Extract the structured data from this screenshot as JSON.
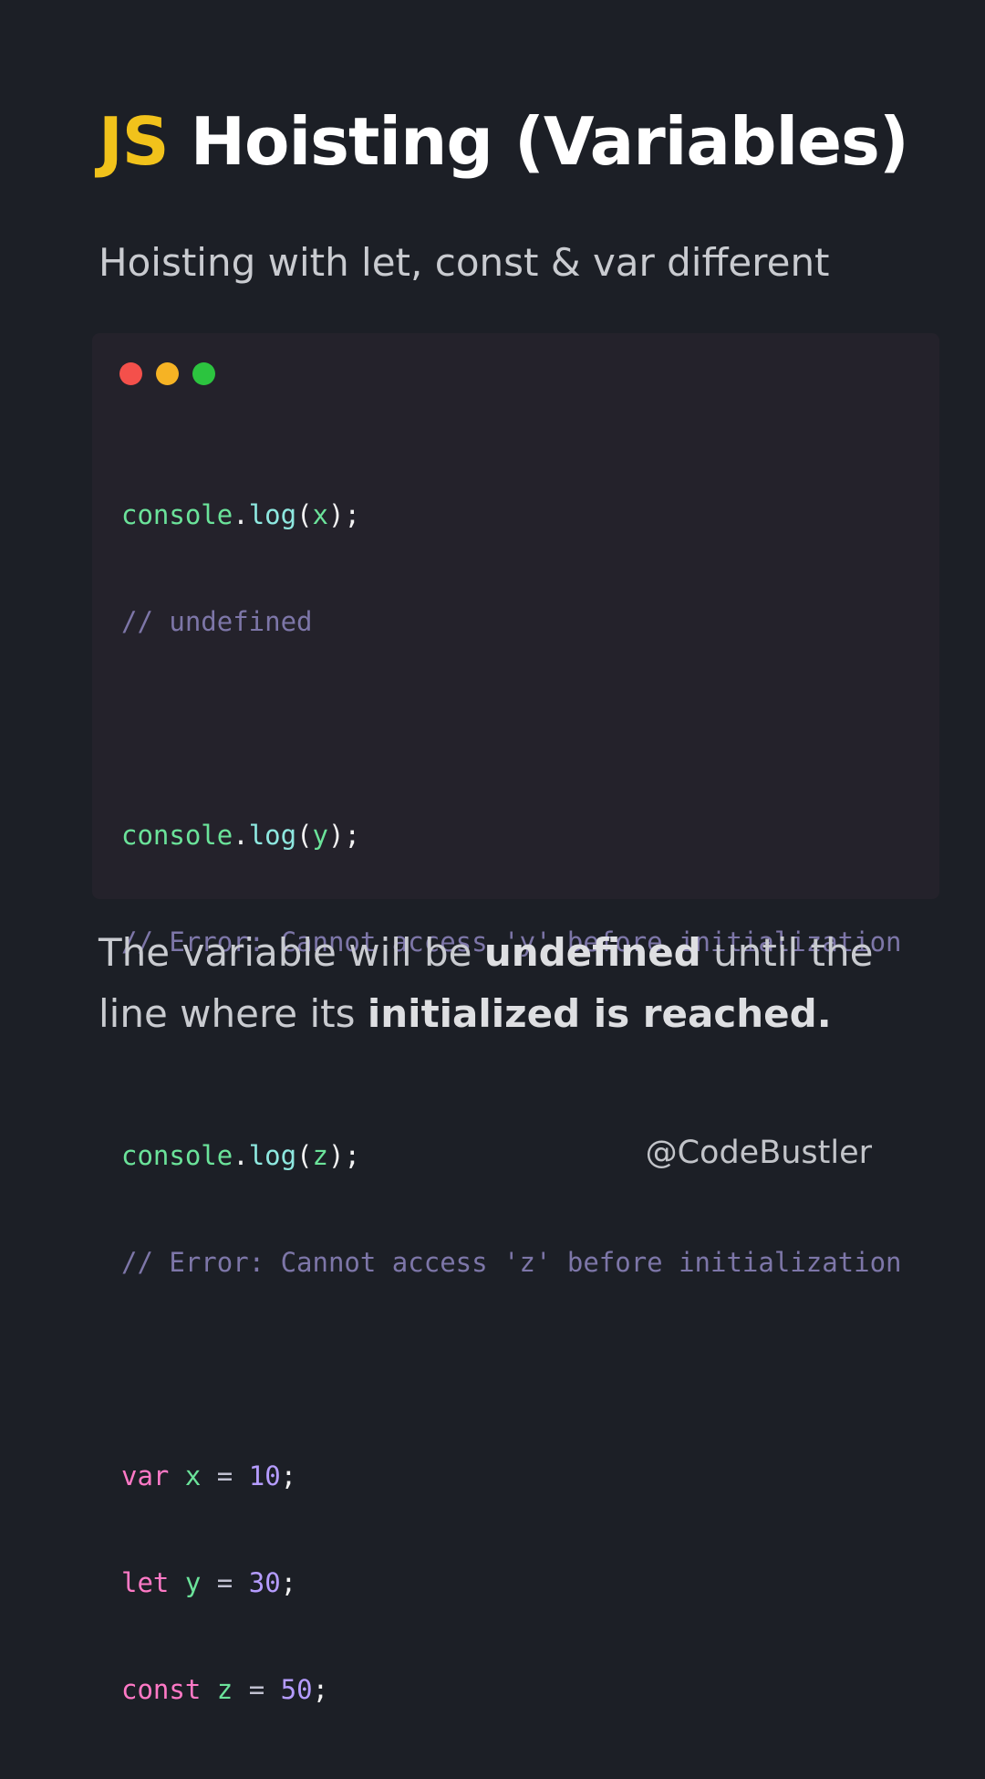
{
  "header": {
    "title_accent": "JS",
    "title_rest": "Hoisting (Variables)",
    "subtitle": "Hoisting with let, const & var different"
  },
  "code_window": {
    "controls": [
      "close",
      "minimize",
      "maximize"
    ],
    "lines": {
      "l1": {
        "obj": "console",
        "dot": ".",
        "method": "log",
        "open": "(",
        "arg": "x",
        "close": ");"
      },
      "l2": {
        "comment": "// undefined"
      },
      "l3": {
        "obj": "console",
        "dot": ".",
        "method": "log",
        "open": "(",
        "arg": "y",
        "close": ");"
      },
      "l4": {
        "comment": "// Error: Cannot access 'y' before initialization"
      },
      "l5": {
        "obj": "console",
        "dot": ".",
        "method": "log",
        "open": "(",
        "arg": "z",
        "close": ");"
      },
      "l6": {
        "comment": "// Error: Cannot access 'z' before initialization"
      },
      "l7": {
        "kw": "var",
        "name": "x",
        "op": "=",
        "num": "10",
        "end": ";"
      },
      "l8": {
        "kw": "let",
        "name": "y",
        "op": "=",
        "num": "30",
        "end": ";"
      },
      "l9": {
        "kw": "const",
        "name": "z",
        "op": "=",
        "num": "50",
        "end": ";"
      }
    }
  },
  "explanation": {
    "part1": "The variable will be ",
    "bold1": "undefined",
    "part2": " until the line where its ",
    "bold2": "initialized is reached."
  },
  "footer": {
    "handle": "@CodeBustler"
  },
  "colors": {
    "background": "#1c1f26",
    "accent": "#f1c21b",
    "code_bg": "#24222b",
    "dot_red": "#f4504b",
    "dot_yellow": "#f6b324",
    "dot_green": "#2cc43f"
  }
}
